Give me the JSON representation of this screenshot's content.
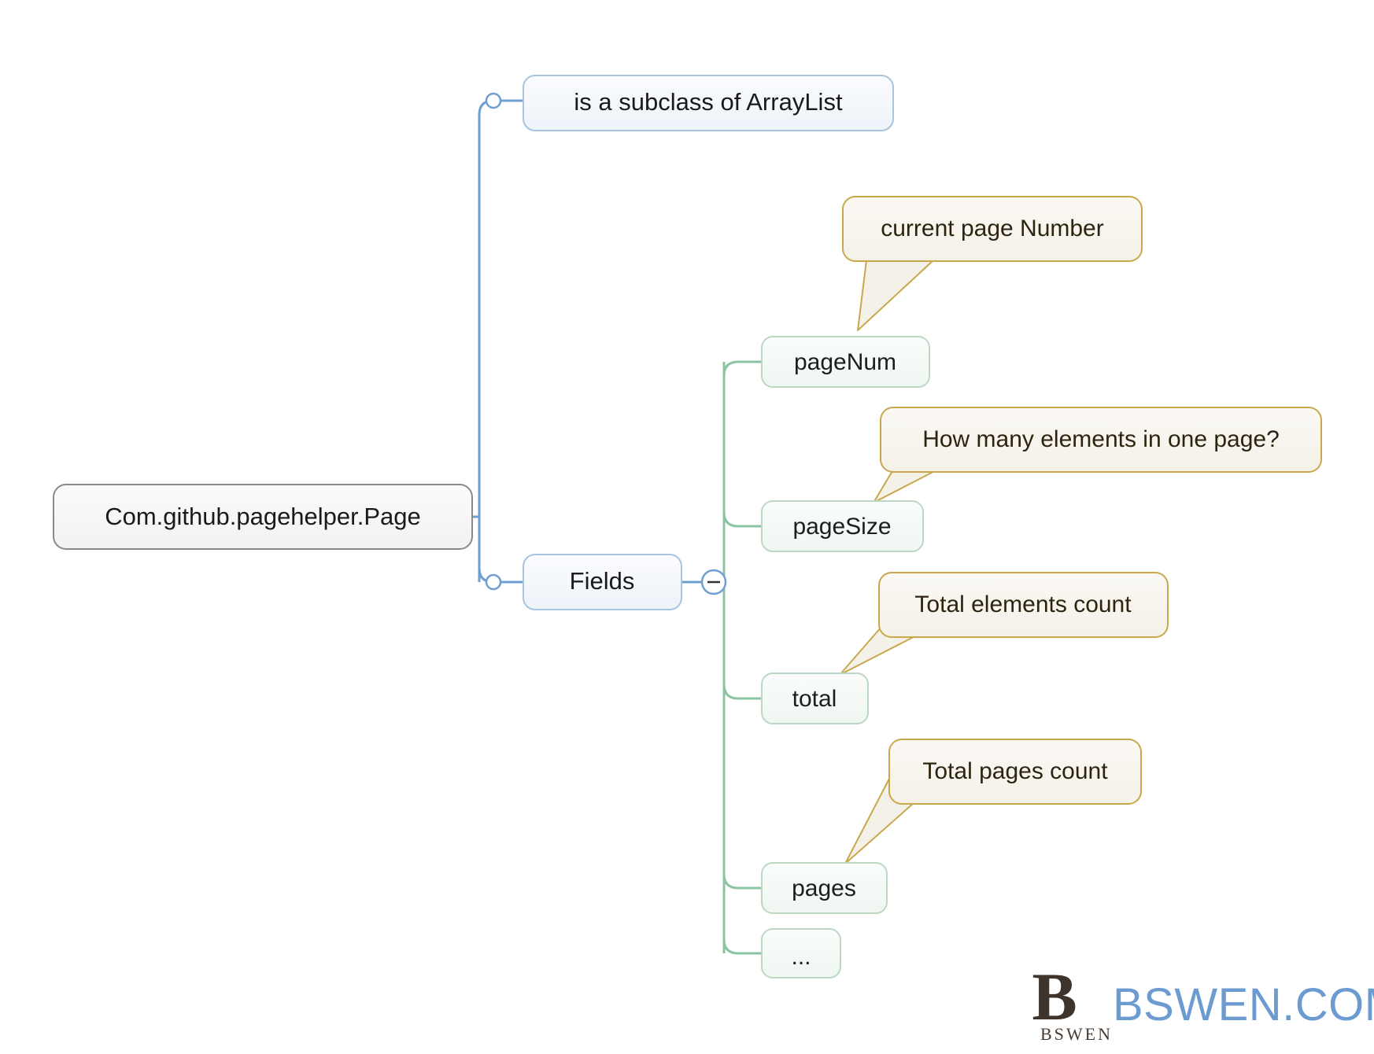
{
  "diagram": {
    "type": "mind-map",
    "title": "Com.github.pagehelper.Page",
    "root": {
      "label": "Com.github.pagehelper.Page",
      "fill": "#f7f7f7",
      "stroke": "#8a8a8a"
    },
    "branches": [
      {
        "label": "is a subclass of ArrayList",
        "fill": "#f5f8fc",
        "stroke": "#a8c4e0",
        "connector": "circle-open"
      },
      {
        "label": "Fields",
        "fill": "#f4f7fb",
        "stroke": "#a8c4e0",
        "connector": "circle-open",
        "collapse_toggle": "minus",
        "children": [
          {
            "label": "pageNum",
            "note": "current page Number"
          },
          {
            "label": "pageSize",
            "note": "How many elements in one page?"
          },
          {
            "label": "total",
            "note": "Total elements count"
          },
          {
            "label": "pages",
            "note": "Total pages count"
          },
          {
            "label": "...",
            "note": null
          }
        ]
      }
    ],
    "field_node_style": {
      "fill": "#f1f7f2",
      "stroke": "#bcd8c2"
    },
    "callout_style": {
      "fill": "#f7f5ee",
      "stroke": "#c9a84c"
    },
    "link_colors": {
      "blue": "#6f9fd0",
      "green": "#8bc4a0"
    }
  },
  "watermark": {
    "monogram": "B",
    "mark_label": "BSWEN",
    "site": "BSWEN.COM",
    "color": "#6c9bd2"
  }
}
